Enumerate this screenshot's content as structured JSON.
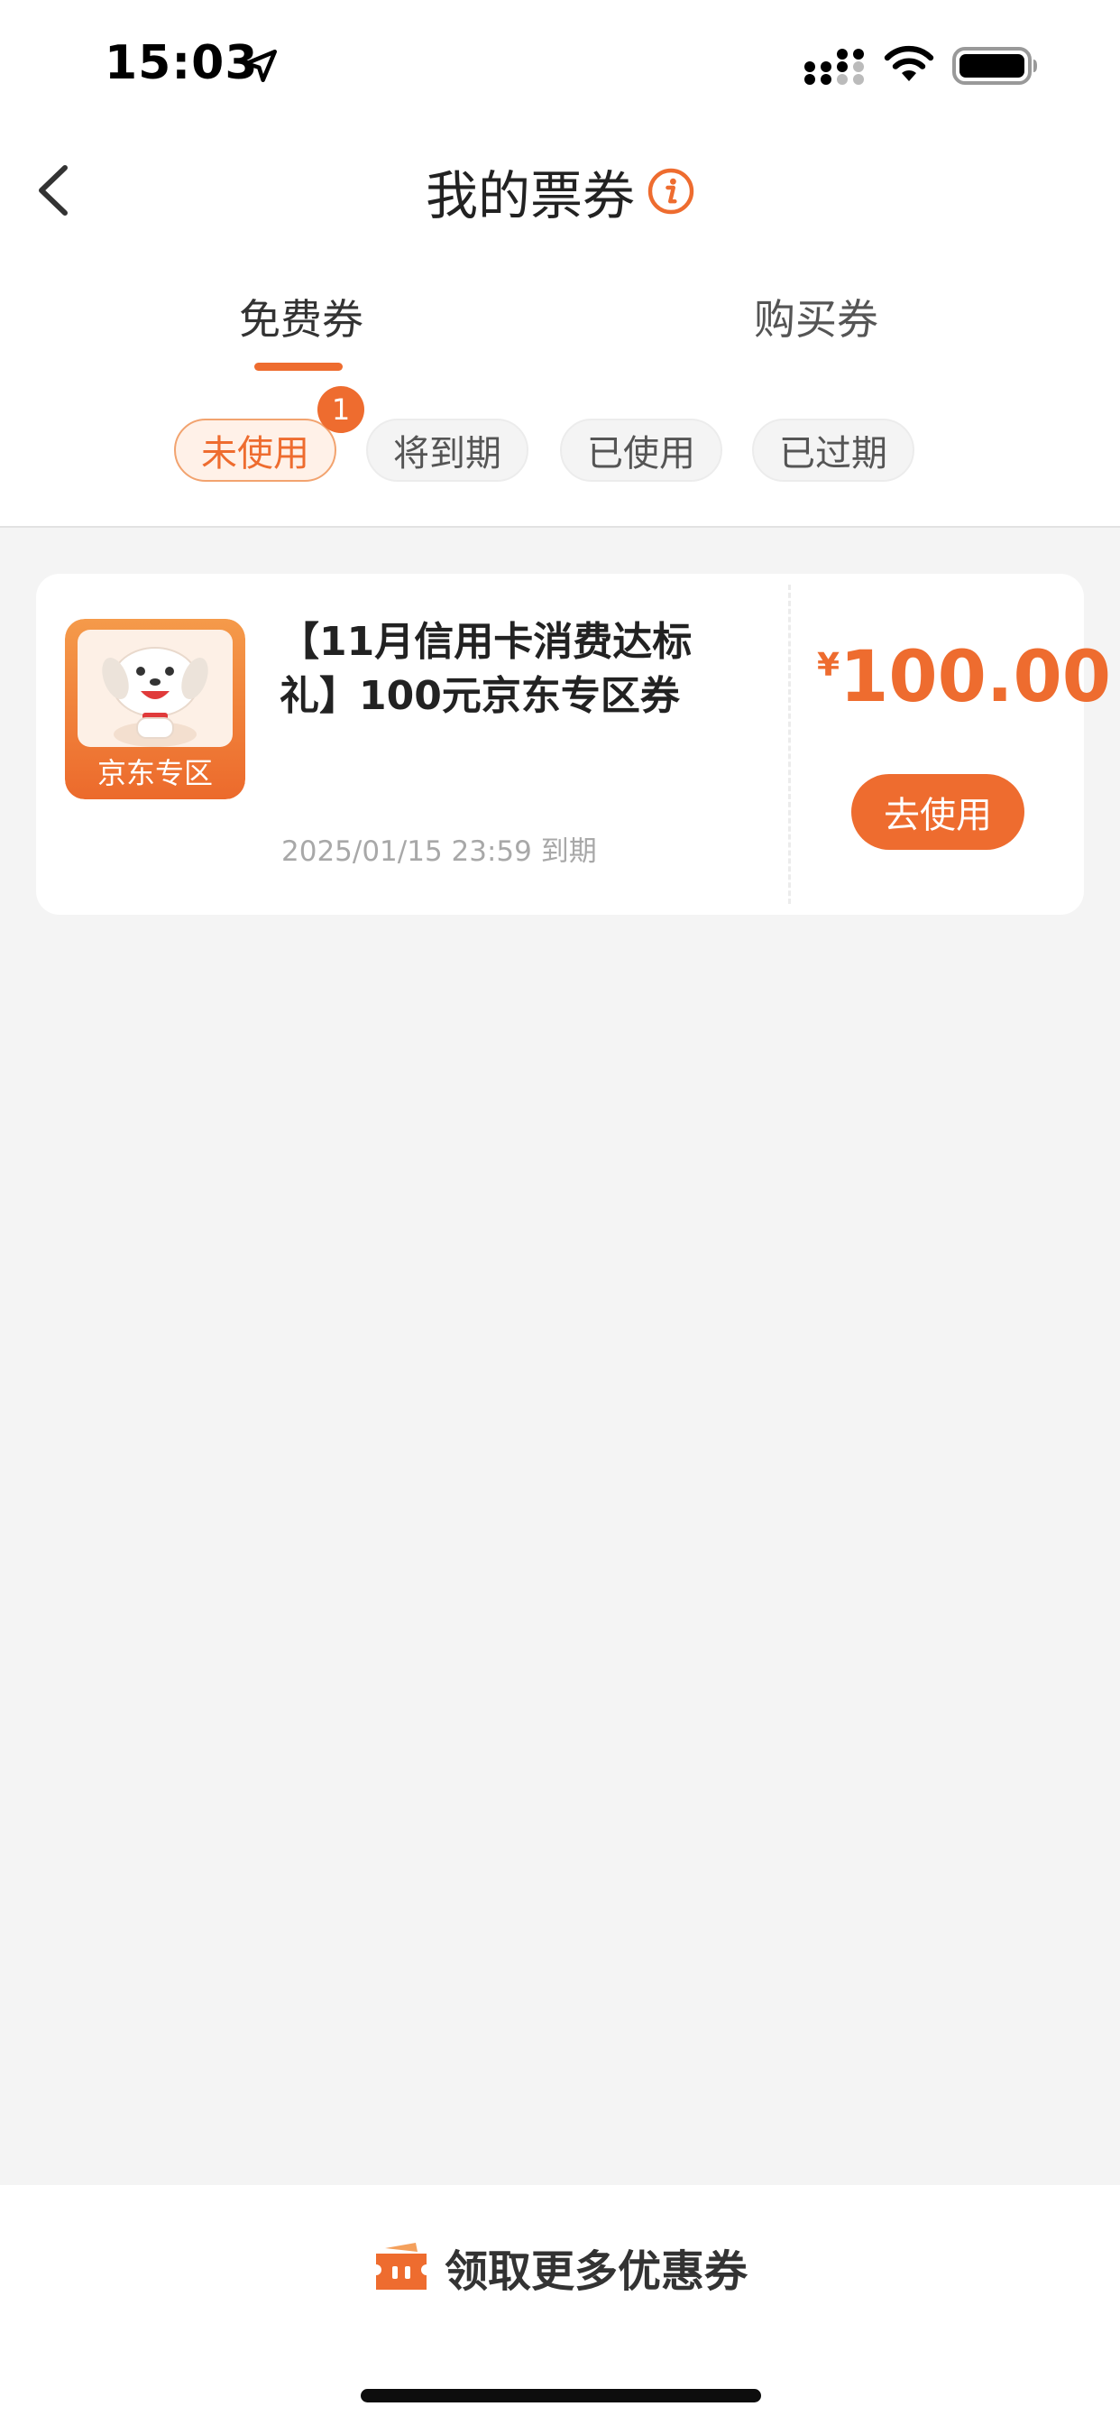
{
  "status_bar": {
    "time": "15:03",
    "icons": [
      "location-arrow-icon",
      "cellular-signal-icon",
      "wifi-icon",
      "battery-icon"
    ]
  },
  "nav": {
    "back_icon": "chevron-left-icon",
    "title": "我的票券",
    "info_icon": "info-icon"
  },
  "tabs": [
    {
      "label": "免费券",
      "active": true
    },
    {
      "label": "购买券",
      "active": false
    }
  ],
  "filters": [
    {
      "label": "未使用",
      "active": true,
      "badge": "1"
    },
    {
      "label": "将到期",
      "active": false
    },
    {
      "label": "已使用",
      "active": false
    },
    {
      "label": "已过期",
      "active": false
    }
  ],
  "coupon": {
    "logo_text": "京东专区",
    "title": "【11月信用卡消费达标礼】100元京东专区券",
    "expiry": "2025/01/15 23:59 到期",
    "currency_symbol": "¥",
    "amount": "100.00",
    "action_label": "去使用"
  },
  "footer": {
    "icon": "ticket-icon",
    "label": "领取更多优惠券"
  },
  "colors": {
    "accent": "#ee6c2f",
    "background": "#f4f4f4",
    "card": "#ffffff",
    "muted_text": "#a8a8a8"
  }
}
